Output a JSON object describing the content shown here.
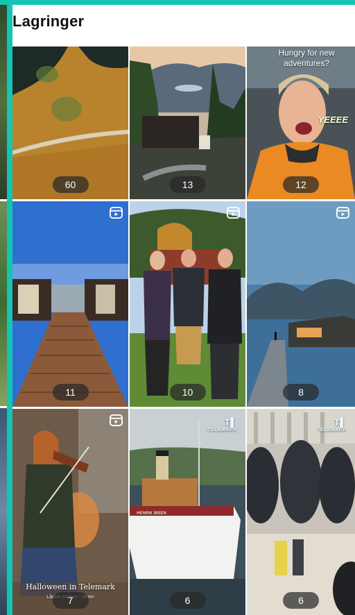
{
  "page": {
    "title": "Lagringer"
  },
  "colors": {
    "accent": "#14c4b4",
    "pill": "#282828"
  },
  "icons": {
    "reel": "reel-icon"
  },
  "tiles": [
    {
      "count": "60"
    },
    {
      "count": "13"
    },
    {
      "count": "12",
      "caption": "Hungry for new adventures?",
      "sticker": "YEEEE"
    },
    {
      "count": "11",
      "reel": true
    },
    {
      "count": "10",
      "reel": true
    },
    {
      "count": "8",
      "reel": true
    },
    {
      "count": "7",
      "reel": true,
      "caption": "Halloween in Telemark",
      "sub": "Lårdal marken · Skien"
    },
    {
      "count": "6",
      "reel": true,
      "watermark": "TELEMARK",
      "ship_name": "HENRIK IBSEN"
    },
    {
      "count": "6",
      "reel": true,
      "watermark": "TELEMARK"
    }
  ]
}
